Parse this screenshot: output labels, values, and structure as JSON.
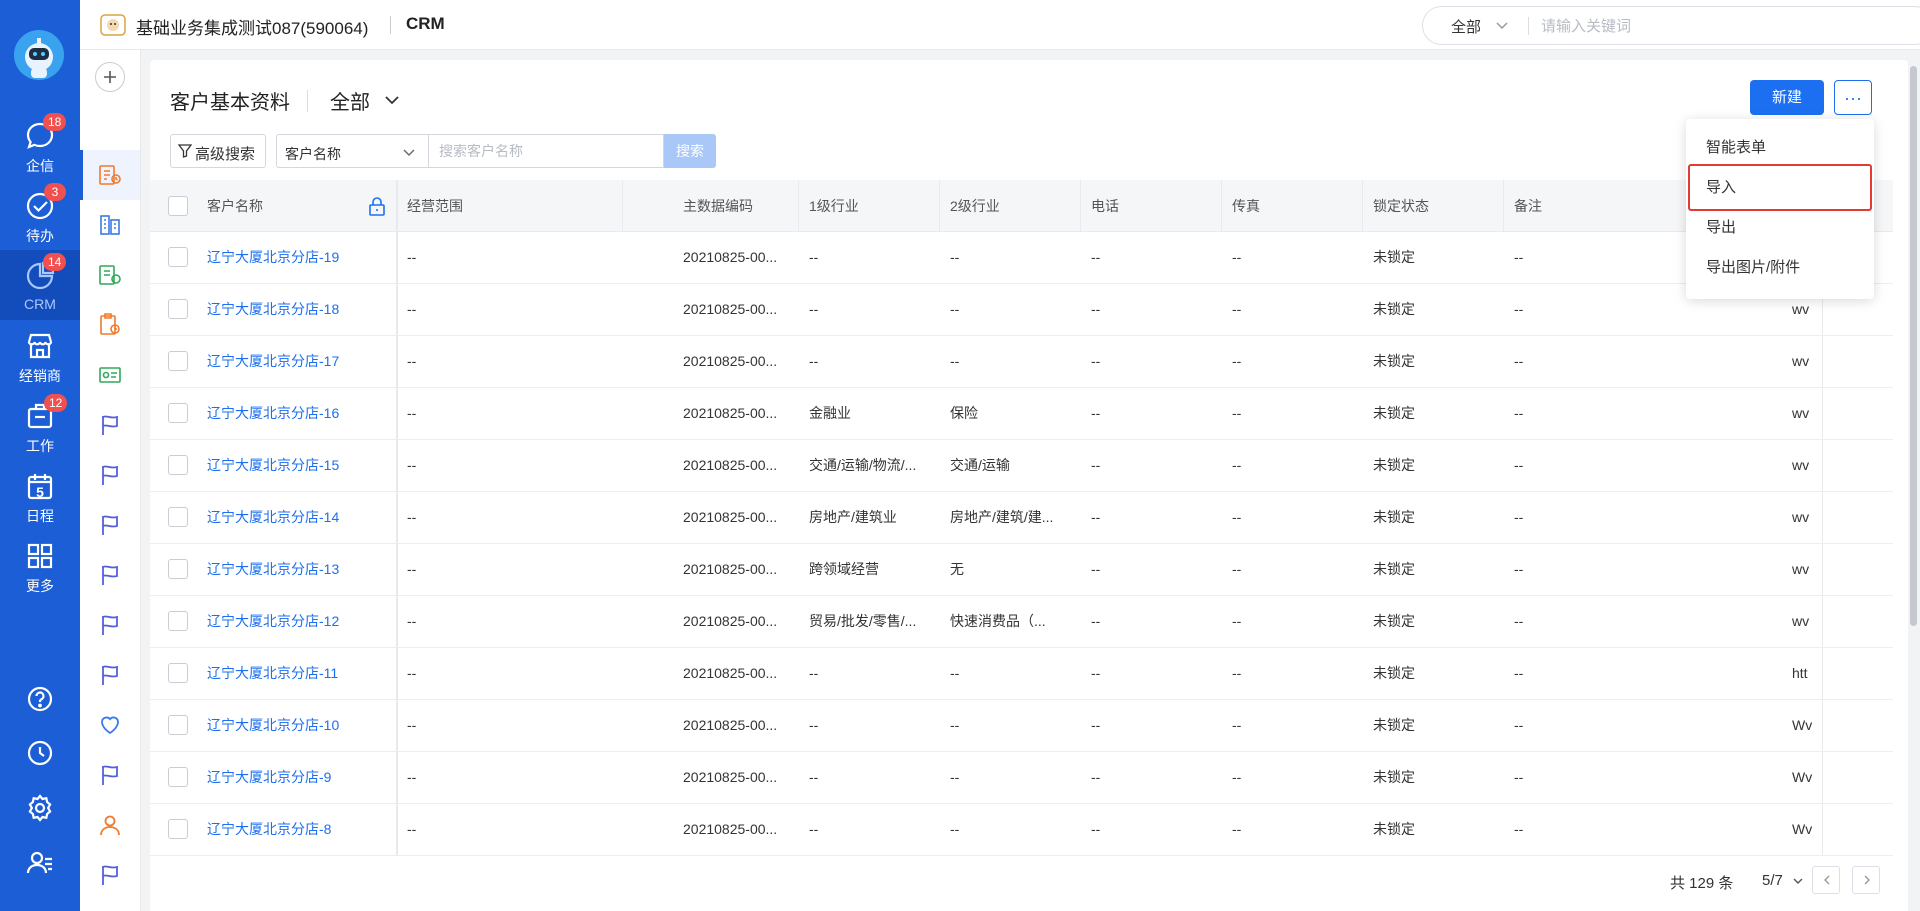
{
  "rail": {
    "items": [
      {
        "label": "企信",
        "badge": "18"
      },
      {
        "label": "待办",
        "badge": "3"
      },
      {
        "label": "CRM",
        "badge": "14"
      },
      {
        "label": "经销商",
        "badge": ""
      },
      {
        "label": "工作",
        "badge": "12"
      },
      {
        "label": "日程",
        "badge": ""
      },
      {
        "label": "更多",
        "badge": ""
      }
    ],
    "calendar_day": "5",
    "accent": "#1c5ed6"
  },
  "header": {
    "org_name": "基础业务集成测试087(590064)",
    "app_name": "CRM",
    "search_scope": "全部",
    "search_placeholder": "请输入关键词"
  },
  "page": {
    "title": "客户基本资料",
    "view": "全部",
    "new_button": "新建",
    "more_button": "···",
    "advanced_search": "高级搜索",
    "field_select": "客户名称",
    "search_placeholder": "搜索客户名称",
    "search_button": "搜索"
  },
  "menu": {
    "items": [
      "智能表单",
      "导入",
      "导出",
      "导出图片/附件"
    ],
    "highlighted": "导入"
  },
  "table": {
    "columns": [
      "客户名称",
      "经营范围",
      "主数据编码",
      "1级行业",
      "2级行业",
      "电话",
      "传真",
      "锁定状态",
      "备注"
    ],
    "rows": [
      {
        "name": "辽宁大厦北京分店-19",
        "scope": "--",
        "code": "20210825-00...",
        "ind1": "--",
        "ind2": "--",
        "phone": "--",
        "fax": "--",
        "lock": "未锁定",
        "note": "--",
        "extra": ""
      },
      {
        "name": "辽宁大厦北京分店-18",
        "scope": "--",
        "code": "20210825-00...",
        "ind1": "--",
        "ind2": "--",
        "phone": "--",
        "fax": "--",
        "lock": "未锁定",
        "note": "--",
        "extra": "wv"
      },
      {
        "name": "辽宁大厦北京分店-17",
        "scope": "--",
        "code": "20210825-00...",
        "ind1": "--",
        "ind2": "--",
        "phone": "--",
        "fax": "--",
        "lock": "未锁定",
        "note": "--",
        "extra": "wv"
      },
      {
        "name": "辽宁大厦北京分店-16",
        "scope": "--",
        "code": "20210825-00...",
        "ind1": "金融业",
        "ind2": "保险",
        "phone": "--",
        "fax": "--",
        "lock": "未锁定",
        "note": "--",
        "extra": "wv"
      },
      {
        "name": "辽宁大厦北京分店-15",
        "scope": "--",
        "code": "20210825-00...",
        "ind1": "交通/运输/物流/...",
        "ind2": "交通/运输",
        "phone": "--",
        "fax": "--",
        "lock": "未锁定",
        "note": "--",
        "extra": "wv"
      },
      {
        "name": "辽宁大厦北京分店-14",
        "scope": "--",
        "code": "20210825-00...",
        "ind1": "房地产/建筑业",
        "ind2": "房地产/建筑/建...",
        "phone": "--",
        "fax": "--",
        "lock": "未锁定",
        "note": "--",
        "extra": "wv"
      },
      {
        "name": "辽宁大厦北京分店-13",
        "scope": "--",
        "code": "20210825-00...",
        "ind1": "跨领域经营",
        "ind2": "无",
        "phone": "--",
        "fax": "--",
        "lock": "未锁定",
        "note": "--",
        "extra": "wv"
      },
      {
        "name": "辽宁大厦北京分店-12",
        "scope": "--",
        "code": "20210825-00...",
        "ind1": "贸易/批发/零售/...",
        "ind2": "快速消费品（...",
        "phone": "--",
        "fax": "--",
        "lock": "未锁定",
        "note": "--",
        "extra": "wv"
      },
      {
        "name": "辽宁大厦北京分店-11",
        "scope": "--",
        "code": "20210825-00...",
        "ind1": "--",
        "ind2": "--",
        "phone": "--",
        "fax": "--",
        "lock": "未锁定",
        "note": "--",
        "extra": "htt"
      },
      {
        "name": "辽宁大厦北京分店-10",
        "scope": "--",
        "code": "20210825-00...",
        "ind1": "--",
        "ind2": "--",
        "phone": "--",
        "fax": "--",
        "lock": "未锁定",
        "note": "--",
        "extra": "Wv"
      },
      {
        "name": "辽宁大厦北京分店-9",
        "scope": "--",
        "code": "20210825-00...",
        "ind1": "--",
        "ind2": "--",
        "phone": "--",
        "fax": "--",
        "lock": "未锁定",
        "note": "--",
        "extra": "Wv"
      },
      {
        "name": "辽宁大厦北京分店-8",
        "scope": "--",
        "code": "20210825-00...",
        "ind1": "--",
        "ind2": "--",
        "phone": "--",
        "fax": "--",
        "lock": "未锁定",
        "note": "--",
        "extra": "Wv"
      }
    ]
  },
  "pager": {
    "total": "共 129 条",
    "page": "5/7"
  }
}
